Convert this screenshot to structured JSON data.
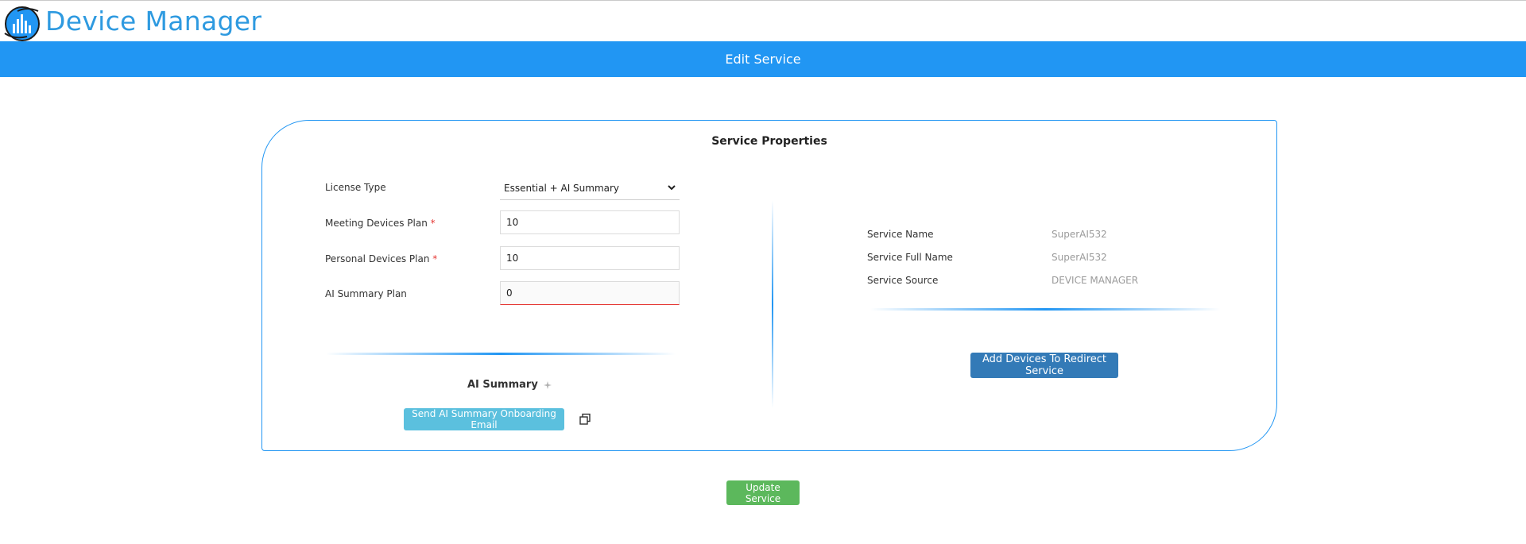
{
  "app": {
    "title": "Device Manager",
    "page_title": "Edit Service"
  },
  "card": {
    "title": "Service Properties"
  },
  "form": {
    "license_type": {
      "label": "License Type",
      "value": "Essential + AI Summary"
    },
    "meeting_devices_plan": {
      "label": "Meeting Devices Plan",
      "required_mark": "*",
      "value": "10"
    },
    "personal_devices_plan": {
      "label": "Personal Devices Plan",
      "required_mark": "*",
      "value": "10"
    },
    "ai_summary_plan": {
      "label": "AI Summary Plan",
      "value": "0"
    }
  },
  "ai_summary": {
    "title": "AI Summary",
    "send_button": "Send AI Summary Onboarding Email"
  },
  "properties": {
    "service_name": {
      "label": "Service Name",
      "value": "SuperAI532"
    },
    "service_full_name": {
      "label": "Service Full Name",
      "value": "SuperAI532"
    },
    "service_source": {
      "label": "Service Source",
      "value": "DEVICE MANAGER"
    }
  },
  "buttons": {
    "add_devices": "Add Devices To Redirect Service",
    "update_service": "Update Service"
  },
  "colors": {
    "primary": "#2196f3",
    "brand_text": "#2e9ae0",
    "info_button": "#5bc0de",
    "add_button": "#337ab7",
    "success_button": "#5cb85c",
    "required": "#e53935"
  },
  "icons": {
    "logo": "device-manager-logo",
    "select_chevron": "chevron-down-icon",
    "sparkle": "sparkle-icon",
    "copy": "copy-icon"
  }
}
